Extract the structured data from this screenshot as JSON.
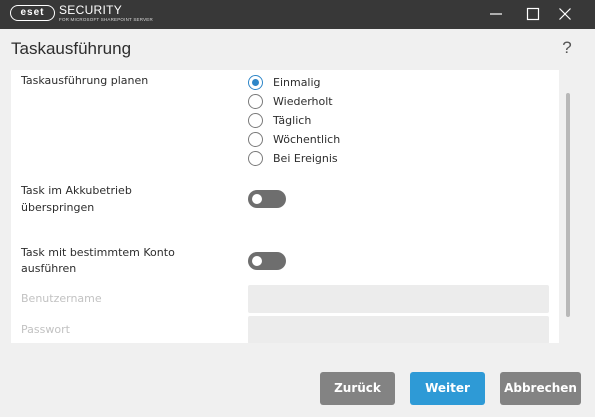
{
  "window": {
    "logo_text": "eset",
    "product_title": "SECURITY",
    "product_subtitle": "FOR MICROSOFT SHAREPOINT SERVER",
    "controls": [
      "minimize-icon",
      "maximize-icon",
      "close-icon"
    ]
  },
  "dialog": {
    "title": "Taskausführung",
    "help_icon": "?"
  },
  "schedule": {
    "label": "Taskausführung planen",
    "selected": "Einmalig",
    "options": [
      "Einmalig",
      "Wiederholt",
      "Täglich",
      "Wöchentlich",
      "Bei Ereignis"
    ]
  },
  "battery": {
    "label_line1": "Task im Akkubetrieb",
    "label_line2": "überspringen",
    "enabled": false
  },
  "account": {
    "label_line1": "Task mit bestimmtem Konto",
    "label_line2": "ausführen",
    "enabled": false
  },
  "credentials": {
    "username_label": "Benutzername",
    "username_value": "",
    "password_label": "Passwort",
    "password_value": ""
  },
  "buttons": {
    "back": "Zurück",
    "next": "Weiter",
    "cancel": "Abbrechen"
  },
  "colors": {
    "titlebar": "#383838",
    "accent": "#2e9ad6",
    "secondary_button": "#838383",
    "toggle_off": "#6e6e6e"
  }
}
